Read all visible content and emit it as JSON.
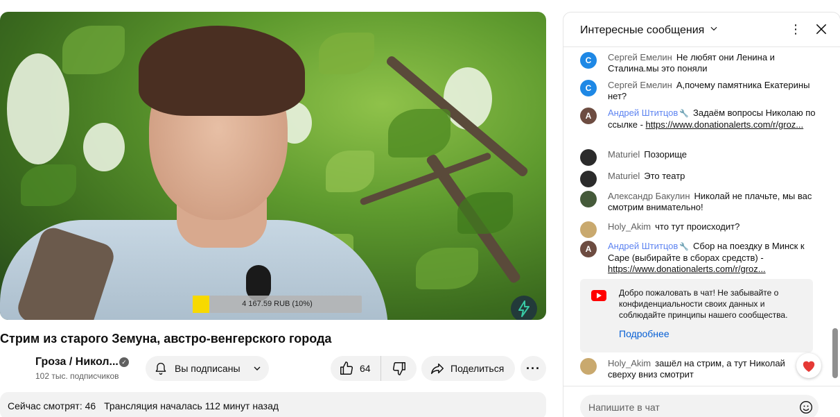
{
  "video": {
    "donation_text": "4 167.59 RUB (10%)",
    "donation_progress_fraction": 0.1,
    "title": "Стрим из старого Земуна, австро-венгерского города"
  },
  "channel": {
    "name": "Гроза / Никол...",
    "subscribers": "102 тыс. подписчиков",
    "verified_icon": "checkmark-circle-icon"
  },
  "actions": {
    "subscribed_label": "Вы подписаны",
    "like_count": "64",
    "share_label": "Поделиться"
  },
  "description": {
    "viewers": "Сейчас смотрят: 46",
    "started": "Трансляция началась 112 минут назад"
  },
  "chat": {
    "title": "Интересные сообщения",
    "messages": [
      {
        "author": "Сергей Емелин",
        "avatar_letter": "С",
        "avatar_color": "#1e88e5",
        "text": "Не любят они Ленина и Сталина.мы это поняли"
      },
      {
        "author": "Сергей Емелин",
        "avatar_letter": "С",
        "avatar_color": "#1e88e5",
        "text": "А,почему памятника Екатерины нет?"
      },
      {
        "author": "Андрей Штитцов",
        "avatar_letter": "А",
        "avatar_color": "#6d4c41",
        "text": "Задаём вопросы Николаю по ссылке - ",
        "link": "https://www.donationalerts.com/r/groz..."
      },
      {
        "author": "Maturiel",
        "avatar_color": "#2b2b2b",
        "text": "Позорище"
      },
      {
        "author": "Maturiel",
        "avatar_color": "#2b2b2b",
        "text": "Это театр"
      },
      {
        "author": "Александр Бакулин",
        "avatar_color": "#455a3a",
        "text": "Николай не плачьте, мы вас смотрим внимательно!"
      },
      {
        "author": "Holy_Akim",
        "avatar_color": "#c9a96e",
        "text": "что тут происходит?"
      },
      {
        "author": "Андрей Штитцов",
        "avatar_letter": "А",
        "avatar_color": "#6d4c41",
        "text": "Сбор на поездку в Минск к Саре (выбирайте в сборах средств) - ",
        "link": "https://www.donationalerts.com/r/groz..."
      },
      {
        "author": "Holy_Akim",
        "avatar_color": "#c9a96e",
        "text": "зашёл на стрим, а тут Николай сверху вниз смотрит"
      }
    ],
    "welcome": {
      "text": "Добро пожаловать в чат! Не забывайте о конфиденциальности своих данных и соблюдайте принципы нашего сообщества.",
      "more": "Подробнее"
    },
    "input_placeholder": "Напишите в чат",
    "accent_color": "#065fd4",
    "mod_color": "#5e84f1"
  }
}
